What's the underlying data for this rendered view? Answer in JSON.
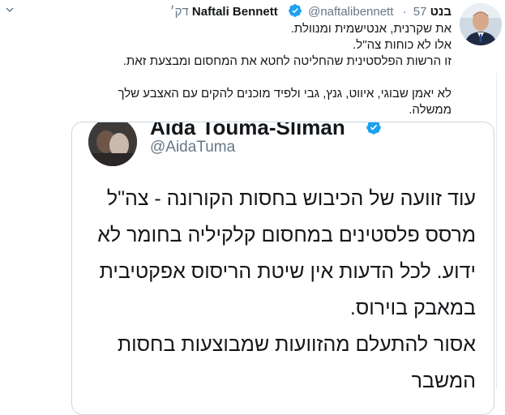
{
  "author": {
    "name_hebrew": "בנט",
    "name_english": "Naftali Bennett",
    "handle": "@naftalibennett",
    "separator": "·",
    "time": "57 דק׳",
    "verified": true
  },
  "tweet": {
    "lines_block1": [
      "את שקרנית, אנטישמית ומנוולת.",
      "אלו לא כוחות צה\"ל.",
      "זו הרשות הפלסטינית שהחליטה לחטא את המחסום ומבצעת זאת."
    ],
    "lines_block2": [
      "לא יאמן שבוגי, איווט, גנץ, גבי ולפיד מוכנים להקים עם האצבע שלך",
      "ממשלה."
    ]
  },
  "quoted": {
    "name": "Aida Touma-Sliman",
    "handle": "@AidaTuma",
    "verified": true,
    "lines": [
      "עוד זוועה של הכיבוש בחסות הקורונה - צה\"ל",
      "מרסס פלסטינים במחסום קלקיליה בחומר לא",
      "ידוע. לכל הדעות אין שיטת הריסוס אפקטיבית",
      "במאבק בוירוס.",
      "אסור להתעלם מהזוועות שמבוצעות בחסות",
      "המשבר"
    ]
  },
  "colors": {
    "verified_blue": "#1da1f2",
    "secondary_text": "#657786",
    "border": "#ccd6dd"
  },
  "icons": [
    "verified-badge-icon",
    "chevron-down-icon"
  ]
}
